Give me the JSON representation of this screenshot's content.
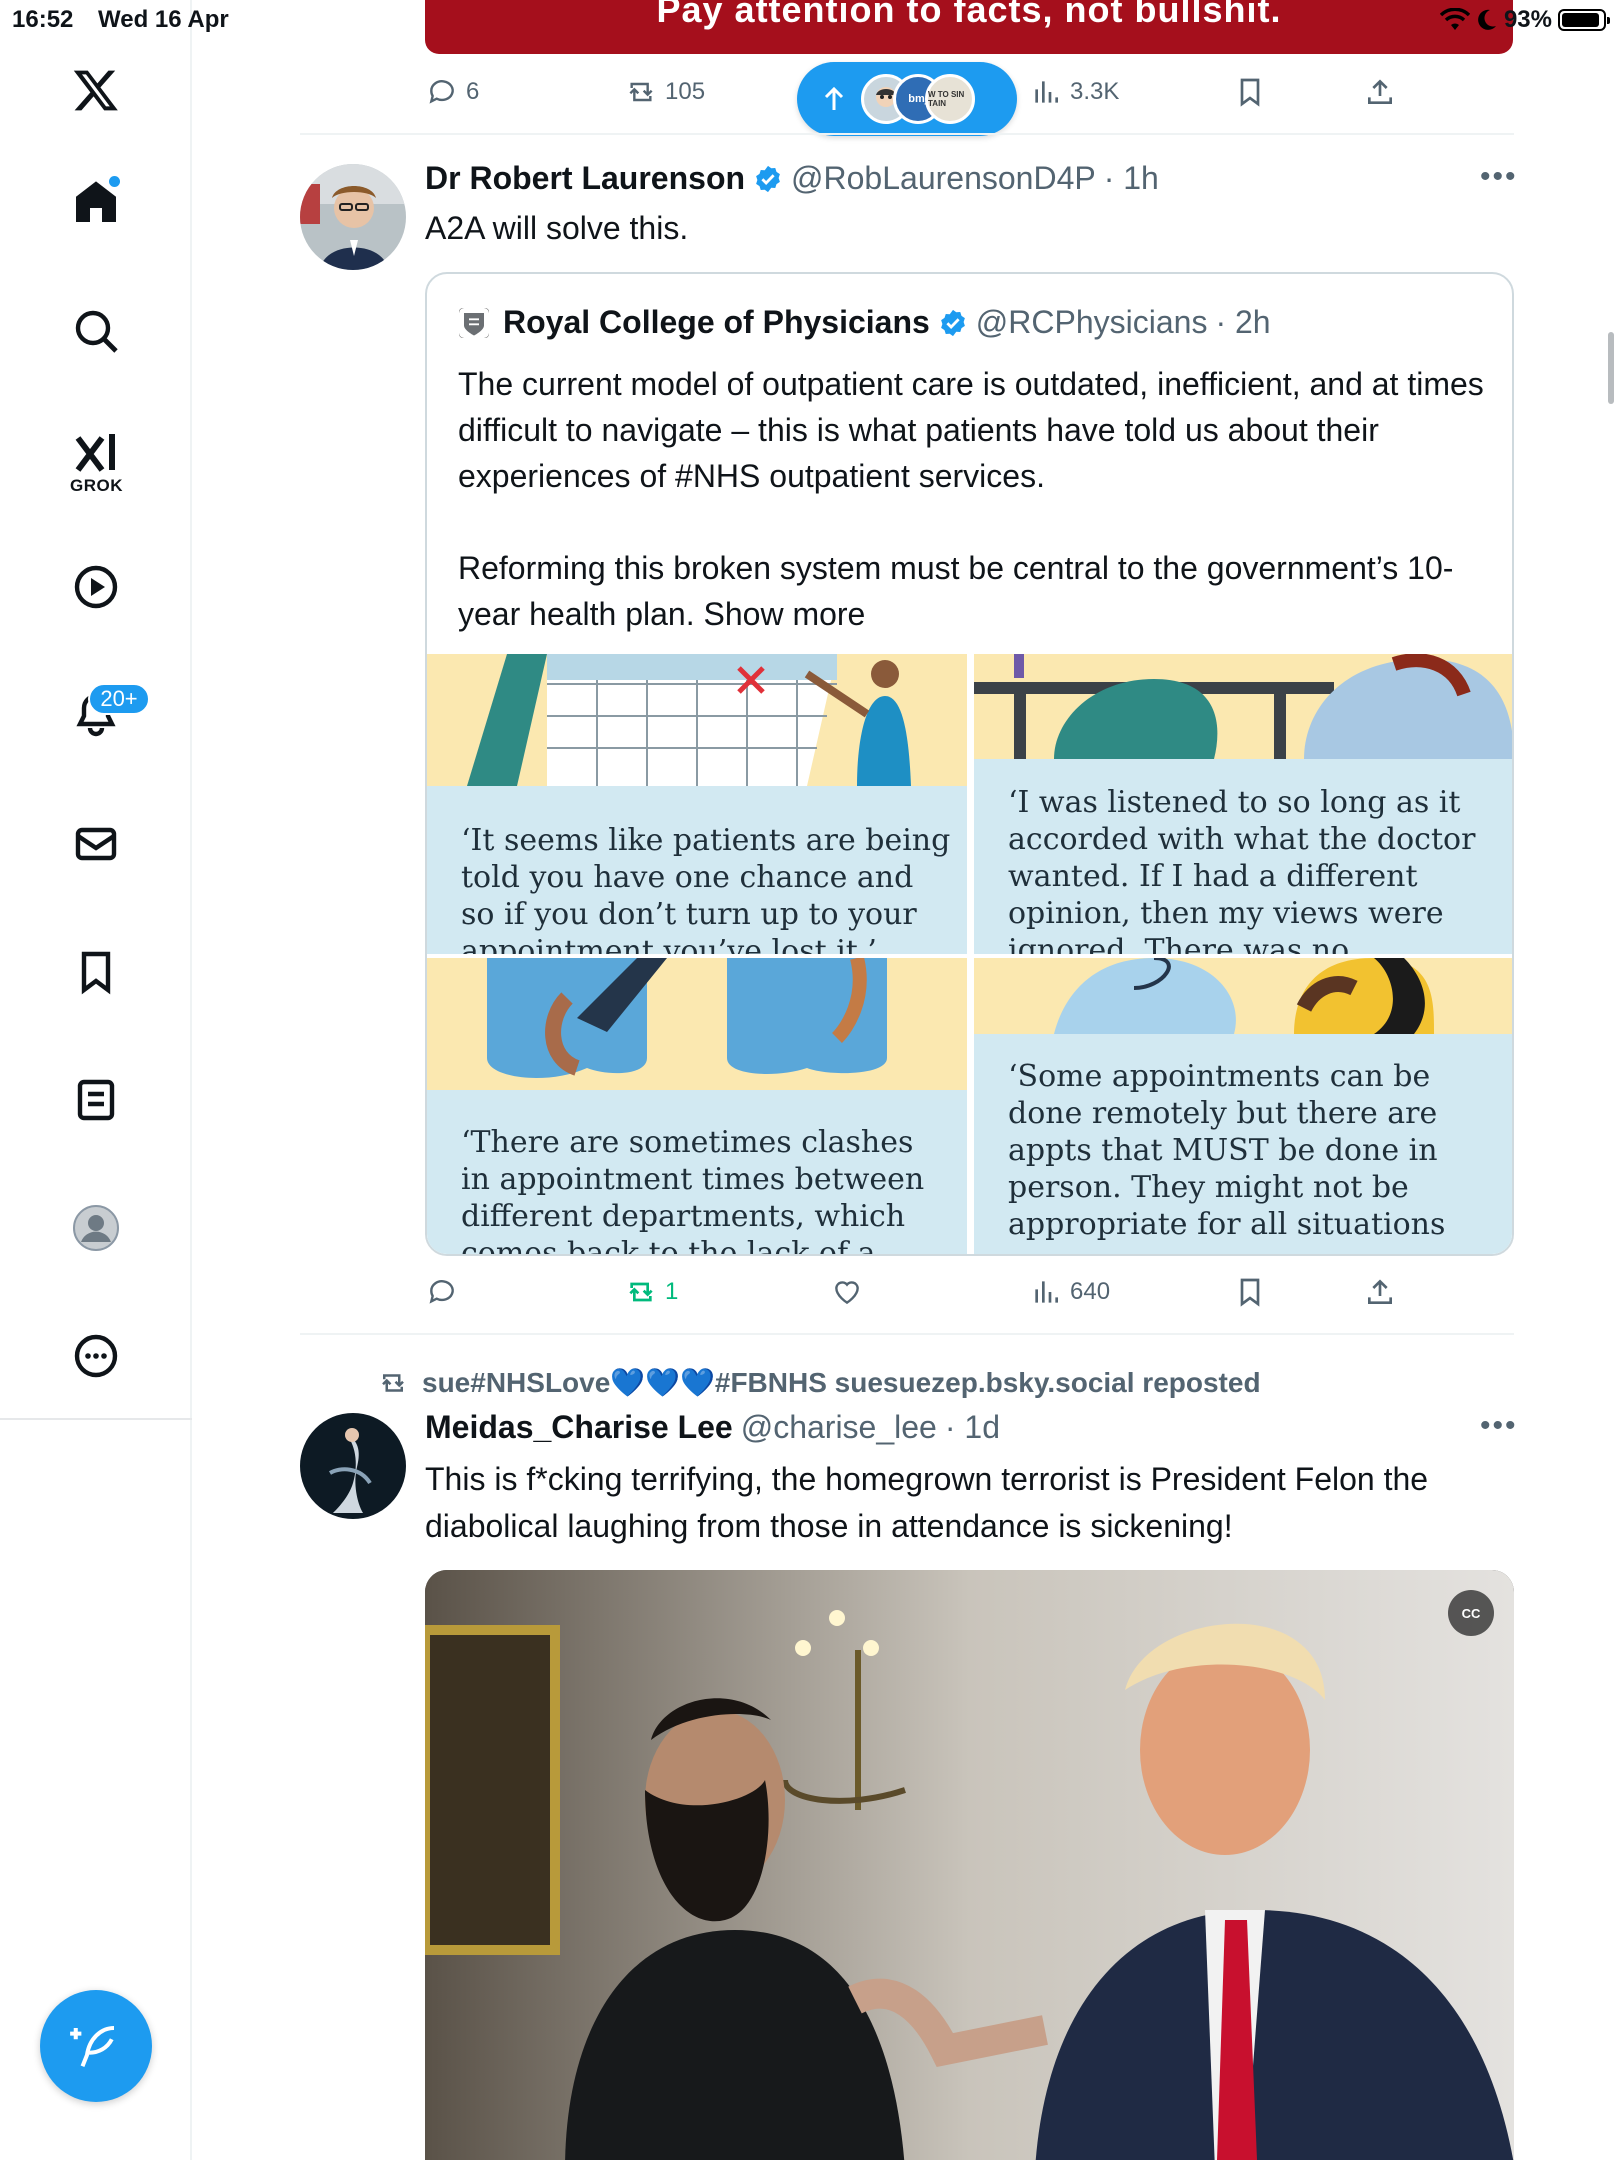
{
  "status_bar": {
    "time": "16:52",
    "date": "Wed 16 Apr",
    "battery": "93%"
  },
  "sidebar": {
    "grok_label": "GROK",
    "notifications_badge": "20+"
  },
  "banner": {
    "text": "Pay attention to facts, not bullshit."
  },
  "tweet0": {
    "replies": "6",
    "reposts": "105",
    "views": "3.3K"
  },
  "new_posts_pill": {
    "avatar_label": "bmj",
    "avatar2_label": "W TO SIN TAIN"
  },
  "tweet1": {
    "name": "Dr Robert Laurenson",
    "handle": "@RobLaurensonD4P",
    "time": "· 1h",
    "text": "A2A will solve this.",
    "quote": {
      "name": "Royal College of Physicians",
      "handle": "@RCPhysicians",
      "time": "· 2h",
      "text": "The current model of outpatient care is outdated, inefficient, and at times difficult to navigate – this is what patients have told us about their experiences of #NHS outpatient services.\n\nReforming this broken system must be central to the government’s 10-year health plan.",
      "show_more": "Show more",
      "panels": [
        "‘It seems like patients are being told you have one chance and so if you don’t turn up to your appointment you’ve lost it.’",
        "‘I was listened to so long as it accorded with what the doctor wanted. If I had a different opinion, then my views were ignored. There was no",
        "‘There are sometimes clashes in appointment times between different departments, which comes back to the lack of a",
        "‘Some appointments can be done remotely but there are appts that MUST be done in person. They might not be appropriate for all situations"
      ]
    },
    "replies": "",
    "reposts": "1",
    "likes": "",
    "views": "640"
  },
  "tweet2": {
    "repost_label": "sue#NHSLove💙💙💙#FBNHS suesuezep.bsky.social reposted",
    "name": "Meidas_Charise Lee",
    "handle": "@charise_lee",
    "time": "· 1d",
    "text": "This is f*cking terrifying,  the homegrown terrorist is President Felon the diabolical laughing from those in attendance is sickening!",
    "cc_label": "CC"
  },
  "colors": {
    "accent": "#1d9bf0",
    "repost_green": "#00ba7c",
    "banner_red": "#a50f1c"
  }
}
